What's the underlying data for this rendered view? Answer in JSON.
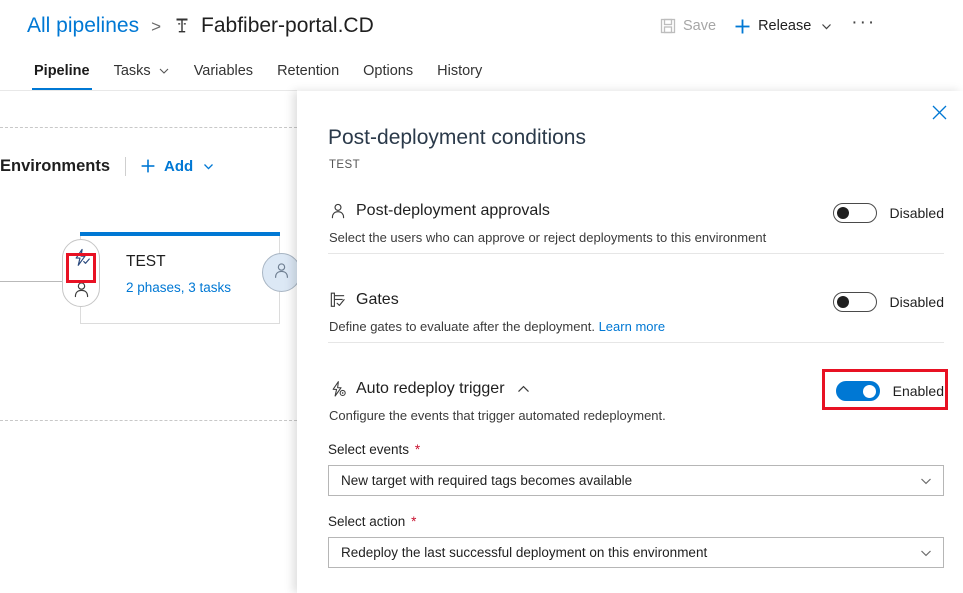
{
  "header": {
    "breadcrumb_root": "All pipelines",
    "breadcrumb_separator": ">",
    "pipeline_icon": "release-pipeline-icon",
    "title": "Fabfiber-portal.CD"
  },
  "toolbar": {
    "save_label": "Save",
    "release_label": "Release",
    "more_label": "···"
  },
  "tabs": [
    {
      "label": "Pipeline",
      "active": true,
      "has_chevron": false
    },
    {
      "label": "Tasks",
      "active": false,
      "has_chevron": true
    },
    {
      "label": "Variables",
      "active": false,
      "has_chevron": false
    },
    {
      "label": "Retention",
      "active": false,
      "has_chevron": false
    },
    {
      "label": "Options",
      "active": false,
      "has_chevron": false
    },
    {
      "label": "History",
      "active": false,
      "has_chevron": false
    }
  ],
  "canvas": {
    "environments_label": "Environments",
    "add_label": "Add",
    "environment": {
      "name": "TEST",
      "summary": "2 phases, 3 tasks",
      "pre_deployment_trigger_icon": "auto-redeploy-trigger-icon",
      "pre_deployment_approval_icon": "pre-deployment-approval-icon",
      "post_deployment_icon": "post-deployment-approval-icon"
    }
  },
  "panel": {
    "title": "Post-deployment conditions",
    "subtitle": "TEST",
    "close_label": "✕",
    "sections": [
      {
        "icon": "person-icon",
        "name": "Post-deployment approvals",
        "description": "Select the users who can approve or reject deployments to this environment",
        "link_text": "",
        "toggle_state": "off",
        "toggle_label": "Disabled",
        "has_chevron": false
      },
      {
        "icon": "gate-icon",
        "name": "Gates",
        "description": "Define gates to evaluate after the deployment.",
        "link_text": "Learn more",
        "toggle_state": "off",
        "toggle_label": "Disabled",
        "has_chevron": false
      },
      {
        "icon": "auto-redeploy-trigger-icon",
        "name": "Auto redeploy trigger",
        "description": "Configure the events that trigger automated redeployment.",
        "link_text": "",
        "toggle_state": "on",
        "toggle_label": "Enabled",
        "has_chevron": true
      }
    ],
    "fields": [
      {
        "label": "Select events",
        "required_marker": "*",
        "value": "New target with required tags becomes available"
      },
      {
        "label": "Select action",
        "required_marker": "*",
        "value": "Redeploy the last successful deployment on this environment"
      }
    ]
  },
  "colors": {
    "accent": "#0078d4",
    "annotation": "#e81123",
    "required": "#c8102e",
    "disabled_text": "#a6a6a6"
  }
}
